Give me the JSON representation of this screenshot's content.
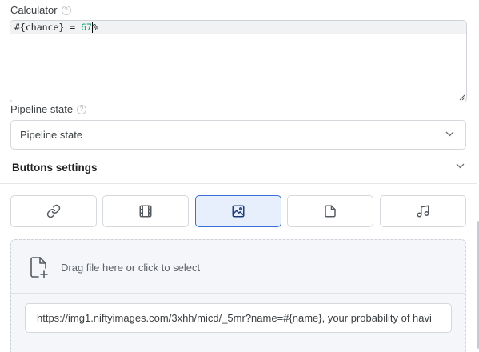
{
  "calculator": {
    "label": "Calculator",
    "code_prefix": "#{chance} = ",
    "code_number": "67",
    "code_suffix": "%"
  },
  "pipeline": {
    "label": "Pipeline state",
    "selected": "Pipeline state"
  },
  "buttons_settings": {
    "title": "Buttons settings"
  },
  "type_buttons": [
    {
      "icon": "link-icon",
      "active": false
    },
    {
      "icon": "film-icon",
      "active": false
    },
    {
      "icon": "image-icon",
      "active": true
    },
    {
      "icon": "file-icon",
      "active": false
    },
    {
      "icon": "music-icon",
      "active": false
    }
  ],
  "upload": {
    "drop_text": "Drag file here or click to select",
    "url_value": "https://img1.niftyimages.com/3xhh/micd/_5mr?name=#{name}, your probability of havi"
  },
  "colors": {
    "accent": "#3a6fd8",
    "active_bg": "#e6effb",
    "number": "#0f9a72"
  }
}
